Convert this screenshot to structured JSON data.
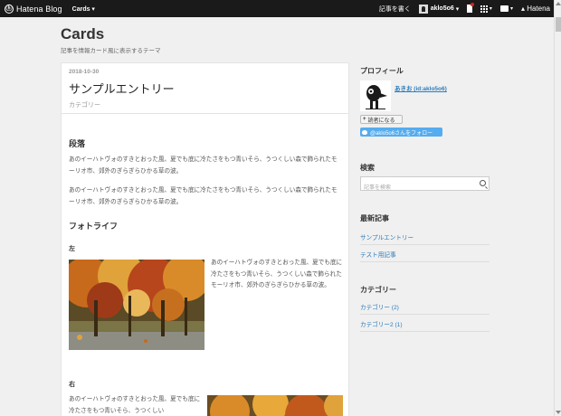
{
  "globalbar": {
    "brand": "Hatena Blog",
    "menu": "Cards",
    "write_label": "記事を書く",
    "username": "aklo5o6",
    "hatena": "Hatena"
  },
  "header": {
    "title": "Cards",
    "description": "記事を情報カード風に表示するテーマ"
  },
  "entry": {
    "date": "2018-10-30",
    "title": "サンプルエントリー",
    "category": "カテゴリー",
    "sections": {
      "paragraph_heading": "段落",
      "paragraph_1": "あのイーハトヴォのすきとおった風、夏でも底に冷たさをもつ青いそら、うつくしい森で飾られたモーリオ市、郊外のぎらぎらひかる草の波。",
      "paragraph_2": "あのイーハトヴォのすきとおった風、夏でも底に冷たさをもつ青いそら、うつくしい森で飾られたモーリオ市、郊外のぎらぎらひかる草の波。",
      "photo_heading": "フォトライフ",
      "left_label": "左",
      "left_text": "あのイーハトヴォのすきとおった風、夏でも底に冷たさをもつ青いそら、うつくしい森で飾られたモーリオ市、郊外のぎらぎらひかる草の波。",
      "right_label": "右",
      "right_text": "あのイーハトヴォのすきとおった風、夏でも底に冷たさをもつ青いそら、うつくしい"
    }
  },
  "sidebar": {
    "profile_heading": "プロフィール",
    "profile_name": "あきお (id:aklo5o6)",
    "reader_button": "読者になる",
    "twitter_button": "@aklo5o6さんをフォロー",
    "search_heading": "検索",
    "search_placeholder": "記事を検索",
    "recent_heading": "最新記事",
    "recent": [
      "サンプルエントリー",
      "テスト用記事"
    ],
    "category_heading": "カテゴリー",
    "categories": [
      "カテゴリー (2)",
      "カテゴリー2 (1)"
    ]
  }
}
